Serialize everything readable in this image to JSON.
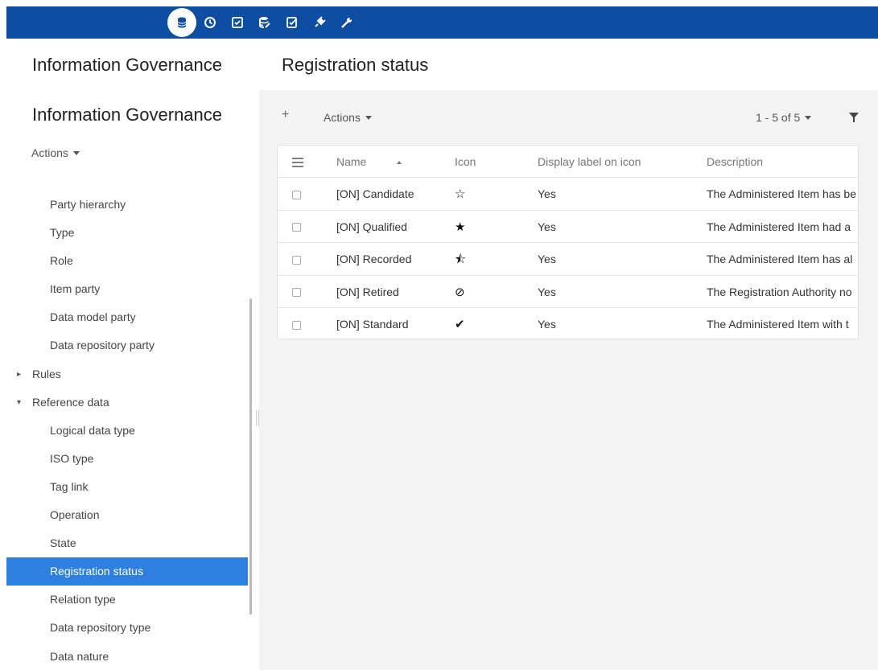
{
  "topbar": {
    "icons": [
      "database-icon",
      "history-icon",
      "checklist-icon",
      "database-edit-icon",
      "approve-icon",
      "plug-icon",
      "wrench-icon"
    ]
  },
  "left": {
    "title": "Information Governance",
    "subtitle": "Information Governance",
    "actions_label": "Actions",
    "tree": [
      {
        "label": "Party hierarchy",
        "level": 1
      },
      {
        "label": "Type",
        "level": 1
      },
      {
        "label": "Role",
        "level": 1
      },
      {
        "label": "Item party",
        "level": 1
      },
      {
        "label": "Data model party",
        "level": 1
      },
      {
        "label": "Data repository party",
        "level": 1
      },
      {
        "label": "Rules",
        "level": 0,
        "toggle": "▸"
      },
      {
        "label": "Reference data",
        "level": 0,
        "toggle": "▾"
      },
      {
        "label": "Logical data type",
        "level": 1
      },
      {
        "label": "ISO type",
        "level": 1
      },
      {
        "label": "Tag link",
        "level": 1
      },
      {
        "label": "Operation",
        "level": 1
      },
      {
        "label": "State",
        "level": 1
      },
      {
        "label": "Registration status",
        "level": 1,
        "selected": true
      },
      {
        "label": "Relation type",
        "level": 1
      },
      {
        "label": "Data repository type",
        "level": 1
      },
      {
        "label": "Data nature",
        "level": 1
      }
    ]
  },
  "main": {
    "title": "Registration status",
    "toolbar": {
      "add": "+",
      "actions_label": "Actions",
      "pager_label": "1 - 5 of 5"
    },
    "columns": [
      "Name",
      "Icon",
      "Display label on icon",
      "Description"
    ],
    "rows": [
      {
        "name": "[ON] Candidate",
        "icon": "☆",
        "icon_name": "star-outline-icon",
        "display": "Yes",
        "description": "The Administered Item has be"
      },
      {
        "name": "[ON] Qualified",
        "icon": "★",
        "icon_name": "star-filled-icon",
        "display": "Yes",
        "description": "The Administered Item had a"
      },
      {
        "name": "[ON] Recorded",
        "icon": "⯪",
        "icon_name": "star-half-icon",
        "display": "Yes",
        "description": "The Administered Item has al"
      },
      {
        "name": "[ON] Retired",
        "icon": "⊘",
        "icon_name": "ban-icon",
        "display": "Yes",
        "description": "The Registration Authority no"
      },
      {
        "name": "[ON] Standard",
        "icon": "✔",
        "icon_name": "check-circle-icon",
        "display": "Yes",
        "description": "The Administered Item with t"
      }
    ]
  },
  "colors": {
    "topbar": "#0d4ea3",
    "selected": "#2f7fe0",
    "content_bg": "#f3f3f3"
  }
}
